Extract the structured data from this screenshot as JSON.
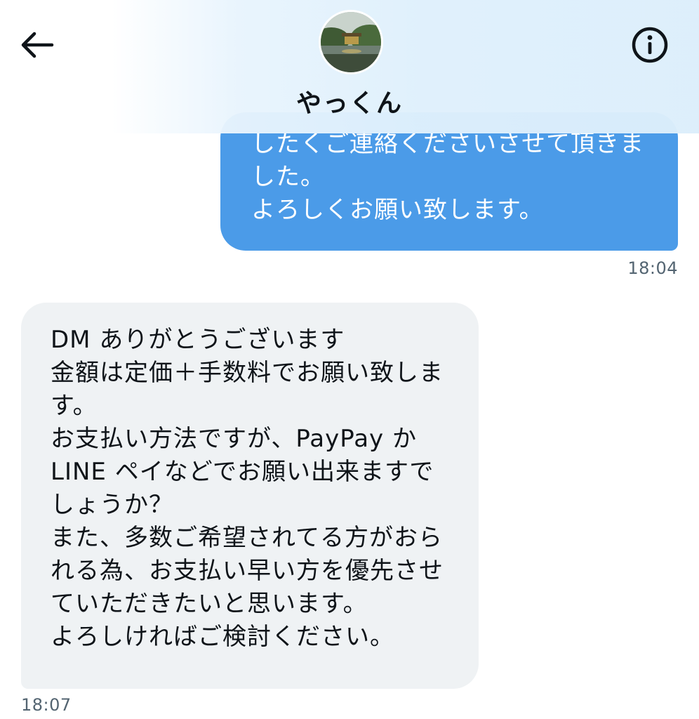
{
  "header": {
    "contact_name": "やっくん",
    "back_icon": "arrow-left-icon",
    "info_icon": "info-circle-icon"
  },
  "messages": [
    {
      "direction": "sent",
      "lines": [
        "したくご連絡くださいさせて頂きま",
        "した。",
        "よろしくお願い致します。"
      ],
      "time": "18:04"
    },
    {
      "direction": "received",
      "lines": [
        "DM ありがとうございます",
        "金額は定価＋手数料でお願い致しま",
        "す。",
        "お支払い方法ですが、PayPay か",
        "LINE ペイなどでお願い出来ますで",
        "しょうか？",
        "また、多数ご希望されてる方がおら",
        "れる為、お支払い早い方を優先させ",
        "ていただきたいと思います。",
        "よろしければご検討ください。"
      ],
      "time": "18:07"
    }
  ],
  "colors": {
    "sent_bubble": "#4b9be8",
    "received_bubble": "#eff2f4",
    "timestamp": "#536471"
  }
}
